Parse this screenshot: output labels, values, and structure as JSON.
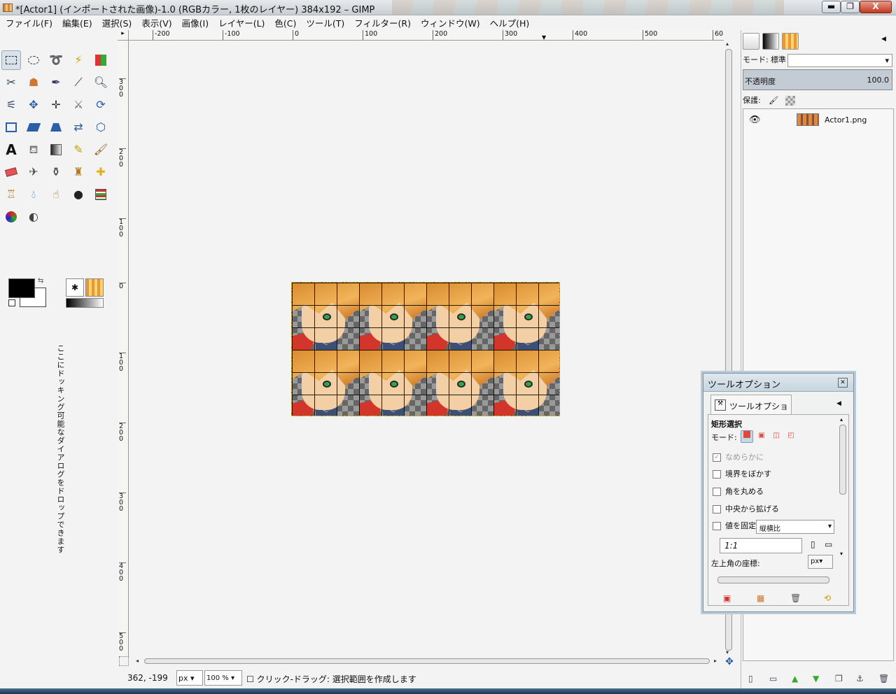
{
  "window": {
    "title": "*[Actor1] (インポートされた画像)-1.0 (RGBカラー, 1枚のレイヤー) 384x192 – GIMP",
    "min_label": "▬",
    "max_label": "❐",
    "close_label": "X"
  },
  "menu": {
    "items": [
      "ファイル(F)",
      "編集(E)",
      "選択(S)",
      "表示(V)",
      "画像(I)",
      "レイヤー(L)",
      "色(C)",
      "ツール(T)",
      "フィルター(R)",
      "ウィンドウ(W)",
      "ヘルプ(H)"
    ]
  },
  "toolbox": {
    "dock_hint": "ここにドッキング可能なダイアログをドロップできます"
  },
  "ruler": {
    "h_labels": [
      "-200",
      "-100",
      "0",
      "100",
      "200",
      "300",
      "400",
      "500",
      "60"
    ],
    "v_labels": [
      "300",
      "200",
      "100",
      "0",
      "100",
      "200",
      "300",
      "400",
      "500"
    ]
  },
  "status": {
    "coords": "362, -199",
    "unit": "px",
    "zoom": "100 %",
    "message": "クリック-ドラッグ: 選択範囲を作成します"
  },
  "layers_dock": {
    "mode_label": "モード:",
    "mode_value": "標準",
    "opacity_label": "不透明度",
    "opacity_value": "100.0",
    "lock_label": "保護:",
    "layer_name": "Actor1.png"
  },
  "tool_options": {
    "window_title": "ツールオプション",
    "tab_label": "ツールオプション",
    "heading": "矩形選択",
    "mode_label": "モード:",
    "antialias": "なめらかに",
    "feather": "境界をぼかす",
    "rounded": "角を丸める",
    "expand_center": "中央から拡げる",
    "fixed": "値を固定",
    "fixed_value": "縦横比",
    "ratio": "1:1",
    "corner_label": "左上角の座標:",
    "corner_unit": "px▾"
  },
  "colors": {
    "accent": "#d9e2ea",
    "foreground": "#000000",
    "background": "#ffffff",
    "selection": "#d8b000"
  }
}
